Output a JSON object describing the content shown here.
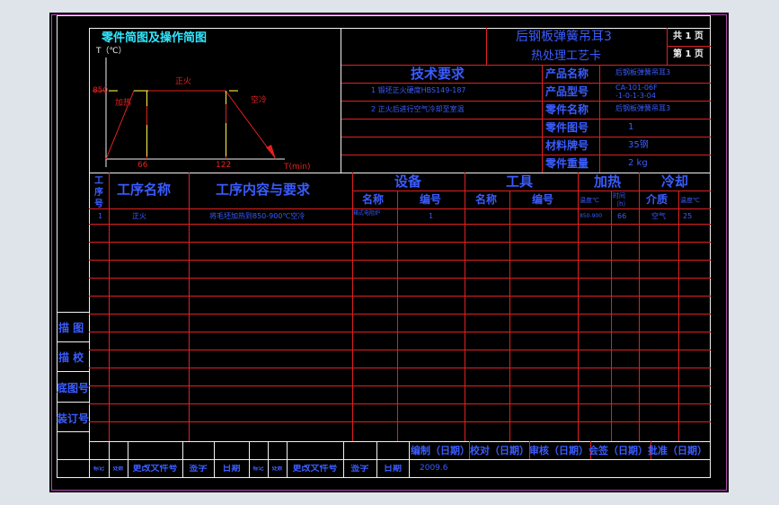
{
  "graph": {
    "title": "零件简图及操作简图",
    "y_axis": "T（℃）",
    "x_axis": "T(min)",
    "temp": "850",
    "t1": "66",
    "t2": "122",
    "heat": "加热",
    "normalize": "正火",
    "aircool": "空冷"
  },
  "header": {
    "title1": "后钢板弹簧吊耳3",
    "title2": "热处理工艺卡",
    "total": "共 1 页",
    "page": "第 1 页"
  },
  "tech": {
    "title": "技术要求",
    "items": [
      "1  锻坯正火硬度HBS149-187",
      "2  正火后进行空气冷却至室温"
    ]
  },
  "part_info": [
    {
      "label": "产品名称",
      "value": "后钢板弹簧吊耳3"
    },
    {
      "label": "产品型号",
      "value": "CA-101-06F\n-1-0-1-3-04"
    },
    {
      "label": "零件名称",
      "value": "后钢板弹簧吊耳3"
    },
    {
      "label": "零件图号",
      "value": "1"
    },
    {
      "label": "材料牌号",
      "value": "35钢"
    },
    {
      "label": "零件重量",
      "value": "2 kg"
    }
  ],
  "table": {
    "col_seq": "工序号",
    "col_name": "工序名称",
    "col_content": "工序内容与要求",
    "equip": "设备",
    "tools": "工具",
    "heating": "加热",
    "cooling": "冷却",
    "sub_name": "名称",
    "sub_no": "编号",
    "sub_name2": "名称",
    "sub_no2": "编号",
    "sub_temp": "温度℃",
    "sub_time": "时间（h）",
    "sub_medium": "介质",
    "sub_temp2": "温度℃",
    "row": {
      "seq": "1",
      "name": "正火",
      "content": "将毛坯加热到850-900℃空冷",
      "equip_name": "箱式电阻炉",
      "equip_no": "1",
      "temp": "850-900",
      "time": "66",
      "medium": "空气",
      "cool_temp": "25"
    }
  },
  "side": [
    "描  图",
    "描  校",
    "底图号",
    "装订号"
  ],
  "sign": {
    "labels": "编制（日期）校对（日期）审核（日期）会签（日期）批准（日期）",
    "date": "2009.6",
    "bottom_cells": [
      "标记",
      "处数",
      "更改文件号",
      "签字",
      "日期",
      "标记",
      "处数",
      "更改文件号",
      "签字",
      "日期"
    ]
  }
}
